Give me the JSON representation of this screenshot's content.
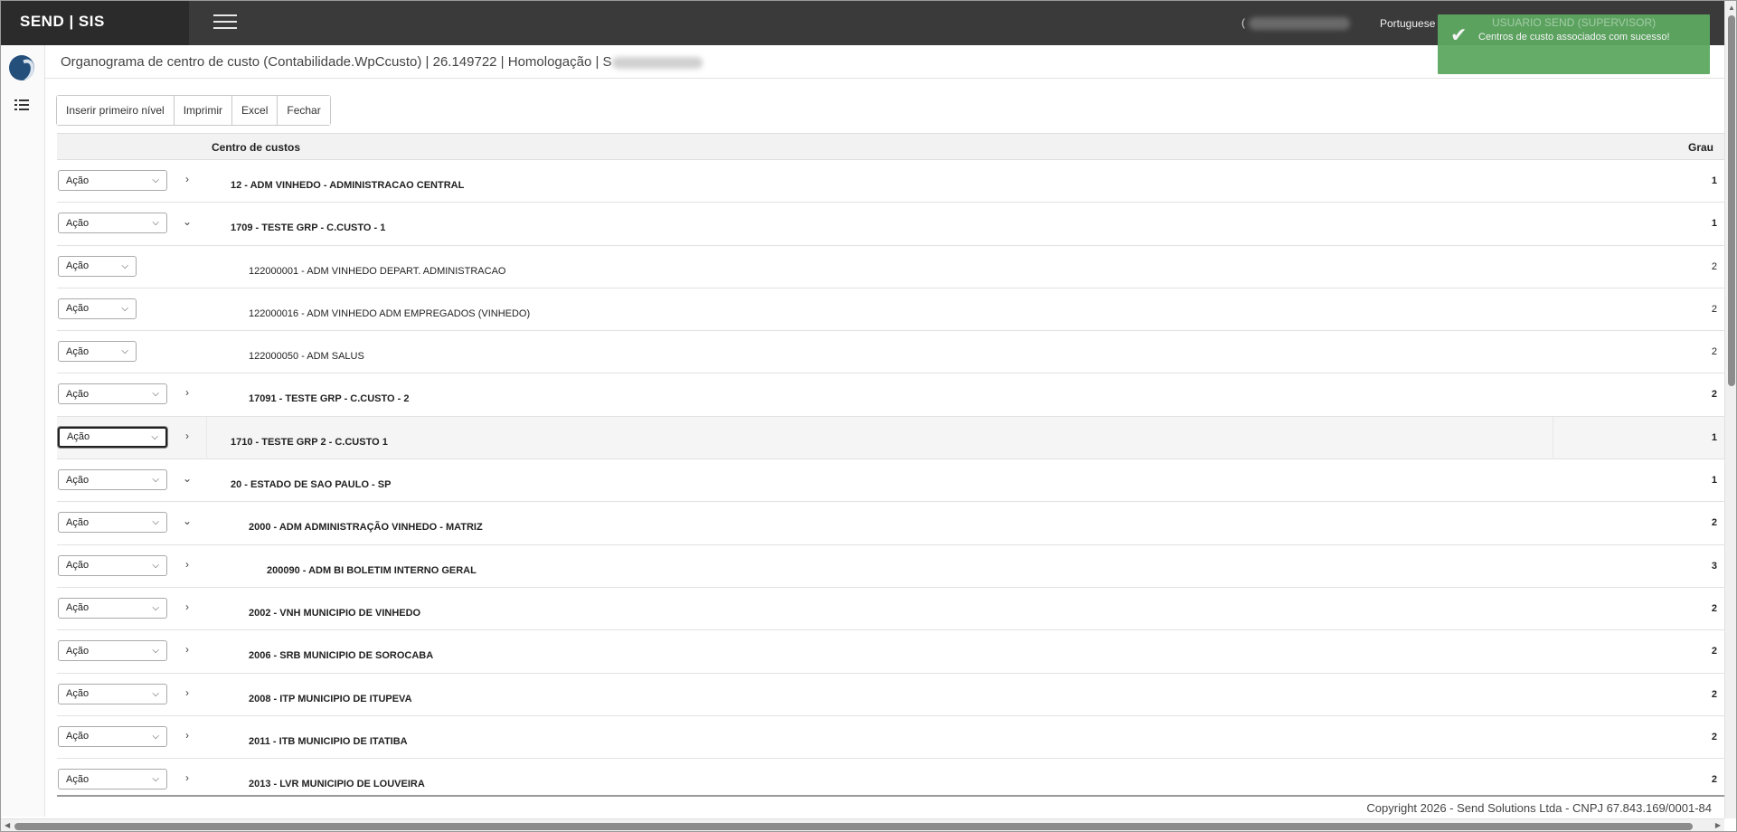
{
  "app": {
    "brand": "SEND | SIS"
  },
  "topbar": {
    "account_prefix": "(",
    "language": "Portuguese"
  },
  "toast": {
    "user": "USUARIO SEND (SUPERVISOR)",
    "message": "Centros de custo associados com sucesso!",
    "color": "#5da862"
  },
  "page": {
    "title": "Organograma de centro de custo (Contabilidade.WpCcusto) | 26.149722 | Homologação | S"
  },
  "toolbar": {
    "insert_label": "Inserir primeiro nível",
    "print_label": "Imprimir",
    "excel_label": "Excel",
    "close_label": "Fechar"
  },
  "table": {
    "col_name": "Centro de custos",
    "col_grau": "Grau",
    "action_label": "Ação",
    "rows": [
      {
        "name": "12 - ADM VINHEDO - ADMINISTRACAO CENTRAL",
        "grau": "1",
        "expander": "›"
      },
      {
        "name": "1709 - TESTE GRP - C.CUSTO - 1",
        "grau": "1",
        "expander": "⌄"
      },
      {
        "name": "122000001 - ADM VINHEDO DEPART. ADMINISTRACAO",
        "grau": "2",
        "expander": ""
      },
      {
        "name": "122000016 - ADM VINHEDO ADM EMPREGADOS (VINHEDO)",
        "grau": "2",
        "expander": ""
      },
      {
        "name": "122000050 - ADM SALUS",
        "grau": "2",
        "expander": ""
      },
      {
        "name": "17091 - TESTE GRP - C.CUSTO - 2",
        "grau": "2",
        "expander": "›"
      },
      {
        "name": "1710 - TESTE GRP 2 - C.CUSTO 1",
        "grau": "1",
        "expander": "›"
      },
      {
        "name": "20 - ESTADO DE SAO PAULO - SP",
        "grau": "1",
        "expander": "⌄"
      },
      {
        "name": "2000 - ADM ADMINISTRAÇÃO VINHEDO - MATRIZ",
        "grau": "2",
        "expander": "⌄"
      },
      {
        "name": "200090 - ADM BI BOLETIM INTERNO GERAL",
        "grau": "3",
        "expander": "›"
      },
      {
        "name": "2002 - VNH MUNICIPIO DE VINHEDO",
        "grau": "2",
        "expander": "›"
      },
      {
        "name": "2006 - SRB MUNICIPIO DE SOROCABA",
        "grau": "2",
        "expander": "›"
      },
      {
        "name": "2008 - ITP MUNICIPIO DE ITUPEVA",
        "grau": "2",
        "expander": "›"
      },
      {
        "name": "2011 - ITB MUNICIPIO DE ITATIBA",
        "grau": "2",
        "expander": "›"
      },
      {
        "name": "2013 - LVR MUNICIPIO DE LOUVEIRA",
        "grau": "2",
        "expander": "›"
      }
    ]
  },
  "footer": {
    "copyright": "Copyright 2026 - Send Solutions Ltda - CNPJ 67.843.169/0001-84"
  }
}
